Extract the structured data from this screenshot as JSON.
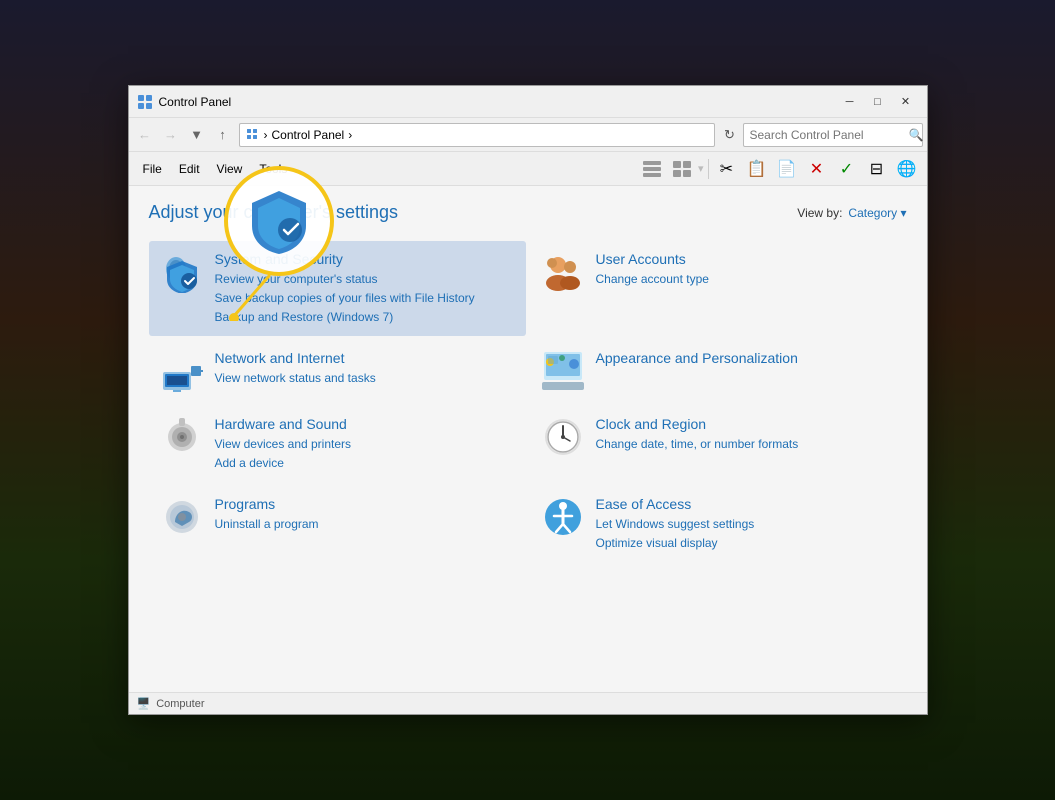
{
  "window": {
    "title": "Control Panel",
    "icon": "🖥️"
  },
  "titlebar": {
    "title": "Control Panel",
    "minimize_label": "─",
    "maximize_label": "□",
    "close_label": "✕"
  },
  "addressbar": {
    "back_tooltip": "Back",
    "forward_tooltip": "Forward",
    "up_tooltip": "Up",
    "path": "Control Panel",
    "path_separator": "›",
    "search_placeholder": "Search Control Panel",
    "refresh_tooltip": "Refresh"
  },
  "toolbar": {
    "menus": [
      "File",
      "Edit",
      "View",
      "Tools"
    ]
  },
  "content": {
    "heading": "Adjust your computer's settings",
    "viewby_label": "View by:",
    "viewby_value": "Category",
    "categories": [
      {
        "id": "system-security",
        "title": "System and Security",
        "links": [
          "Review your computer's status",
          "Save backup copies of your files with File History",
          "Backup and Restore (Windows 7)"
        ],
        "selected": true
      },
      {
        "id": "user-accounts",
        "title": "User Accounts",
        "links": [
          "Change account type"
        ]
      },
      {
        "id": "network-internet",
        "title": "Network and Internet",
        "links": [
          "View network status and tasks"
        ]
      },
      {
        "id": "appearance-personalization",
        "title": "Appearance and Personalization",
        "links": []
      },
      {
        "id": "hardware-sound",
        "title": "Hardware and Sound",
        "links": [
          "View devices and printers",
          "Add a device"
        ]
      },
      {
        "id": "clock-region",
        "title": "Clock and Region",
        "links": [
          "Change date, time, or number formats"
        ]
      },
      {
        "id": "programs",
        "title": "Programs",
        "links": [
          "Uninstall a program"
        ]
      },
      {
        "id": "ease-of-access",
        "title": "Ease of Access",
        "links": [
          "Let Windows suggest settings",
          "Optimize visual display"
        ]
      }
    ]
  },
  "statusbar": {
    "computer_icon": "🖥️",
    "computer_label": "Computer"
  },
  "annotation": {
    "circle_icon": "🛡️"
  }
}
